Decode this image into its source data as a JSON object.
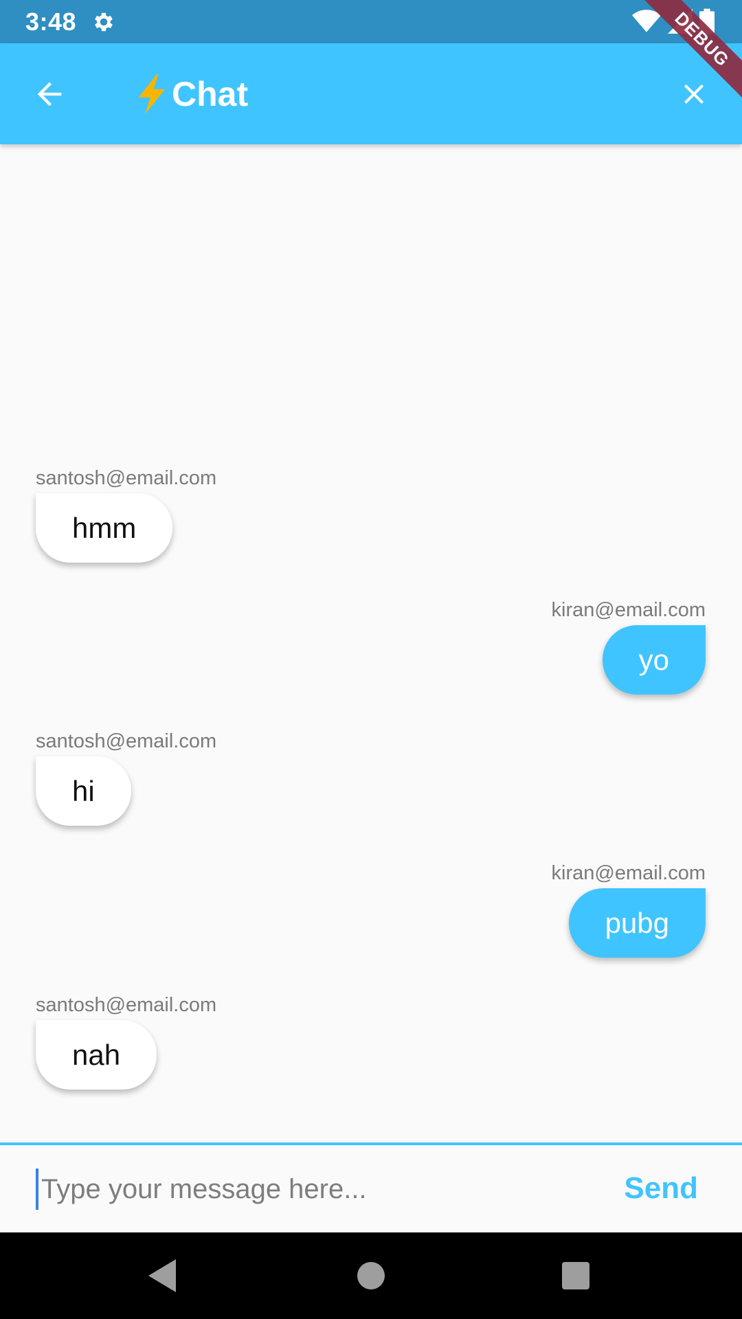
{
  "status_bar": {
    "time": "3:48",
    "icons": [
      "gear-icon",
      "wifi-icon",
      "signal-icon",
      "battery-icon"
    ]
  },
  "debug_ribbon": "DEBUG",
  "app_bar": {
    "title": "Chat",
    "title_icon": "lightning-bolt-icon",
    "back_icon": "arrow-left-icon",
    "close_icon": "close-icon",
    "background": "#40c4ff"
  },
  "messages": [
    {
      "sender": "santosh@email.com",
      "text": "hmm",
      "is_me": false
    },
    {
      "sender": "kiran@email.com",
      "text": "yo",
      "is_me": true
    },
    {
      "sender": "santosh@email.com",
      "text": "hi",
      "is_me": false
    },
    {
      "sender": "kiran@email.com",
      "text": "pubg",
      "is_me": true
    },
    {
      "sender": "santosh@email.com",
      "text": "nah",
      "is_me": false
    }
  ],
  "composer": {
    "placeholder": "Type your message here...",
    "value": "",
    "send_label": "Send"
  },
  "nav_bar": {
    "icons": [
      "nav-back-icon",
      "nav-home-icon",
      "nav-recents-icon"
    ]
  },
  "colors": {
    "accent": "#40c4ff",
    "status_bar": "#2f8fc2",
    "background": "#fafafa",
    "other_bubble": "#ffffff"
  }
}
